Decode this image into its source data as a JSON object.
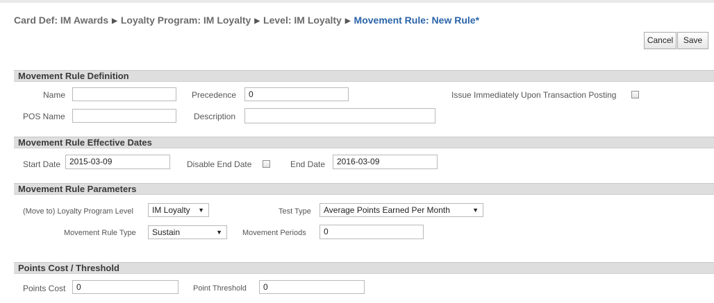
{
  "breadcrumb": {
    "items": [
      "Card Def: IM Awards",
      "Loyalty Program: IM Loyalty",
      "Level: IM Loyalty"
    ],
    "current": "Movement Rule: New Rule*",
    "separator": "▶"
  },
  "toolbar": {
    "cancel_label": "Cancel",
    "save_label": "Save"
  },
  "definition": {
    "title": "Movement Rule Definition",
    "name_label": "Name",
    "name_value": "",
    "precedence_label": "Precedence",
    "precedence_value": "0",
    "issue_label": "Issue Immediately Upon Transaction Posting",
    "issue_checked": false,
    "pos_name_label": "POS Name",
    "pos_name_value": "",
    "description_label": "Description",
    "description_value": ""
  },
  "dates": {
    "title": "Movement Rule Effective Dates",
    "start_label": "Start Date",
    "start_value": "2015-03-09",
    "disable_end_label": "Disable End Date",
    "disable_end_checked": false,
    "end_label": "End Date",
    "end_value": "2016-03-09"
  },
  "parameters": {
    "title": "Movement Rule Parameters",
    "level_label": "(Move to) Loyalty Program Level",
    "level_value": "IM Loyalty",
    "test_type_label": "Test Type",
    "test_type_value": "Average Points Earned Per Month",
    "rule_type_label": "Movement Rule Type",
    "rule_type_value": "Sustain",
    "periods_label": "Movement Periods",
    "periods_value": "0"
  },
  "points": {
    "title": "Points Cost / Threshold",
    "cost_label": "Points Cost",
    "cost_value": "0",
    "threshold_label": "Point Threshold",
    "threshold_value": "0"
  },
  "icons": {
    "caret": "▼",
    "separator": "triangle-right-icon"
  }
}
